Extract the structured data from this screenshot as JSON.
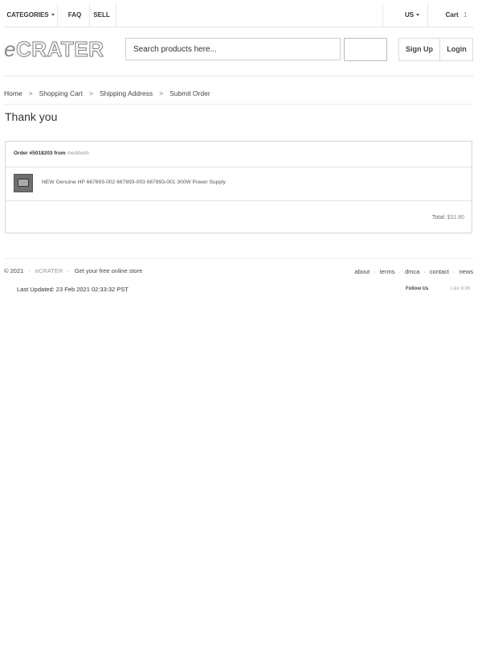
{
  "topbar": {
    "categories_label": "CATEGORIES",
    "faq_label": "FAQ",
    "sell_label": "SELL",
    "country_label": "US",
    "cart_label": "Cart",
    "cart_count": "1"
  },
  "header": {
    "logo_e": "e",
    "logo_rest": "CRATER",
    "search_placeholder": "Search products here...",
    "signup_label": "Sign Up",
    "login_label": "Login"
  },
  "breadcrumb": [
    "Home",
    "Shopping Cart",
    "Shipping Address",
    "Submit Order"
  ],
  "breadcrumb_separator": ">",
  "page_title": "Thank you",
  "order": {
    "label": "Order #5018203",
    "from_label": "from",
    "seller": "mediherb",
    "item_name": "NEW Genuine HP 667893-002 667893-003 667893-001 300W Power Supply",
    "total_label": "Total:",
    "total_value": "$31.80"
  },
  "footer": {
    "copyright": "© 2021",
    "brand": "eCRATER",
    "tagline": "Get your free online store",
    "links": [
      "about",
      "terms",
      "dmca",
      "contact",
      "news"
    ],
    "last_updated": "Last Updated: 23 Feb 2021 02:33:32 PST",
    "follow_us": "Follow Us",
    "like": "Like 9.9K"
  }
}
